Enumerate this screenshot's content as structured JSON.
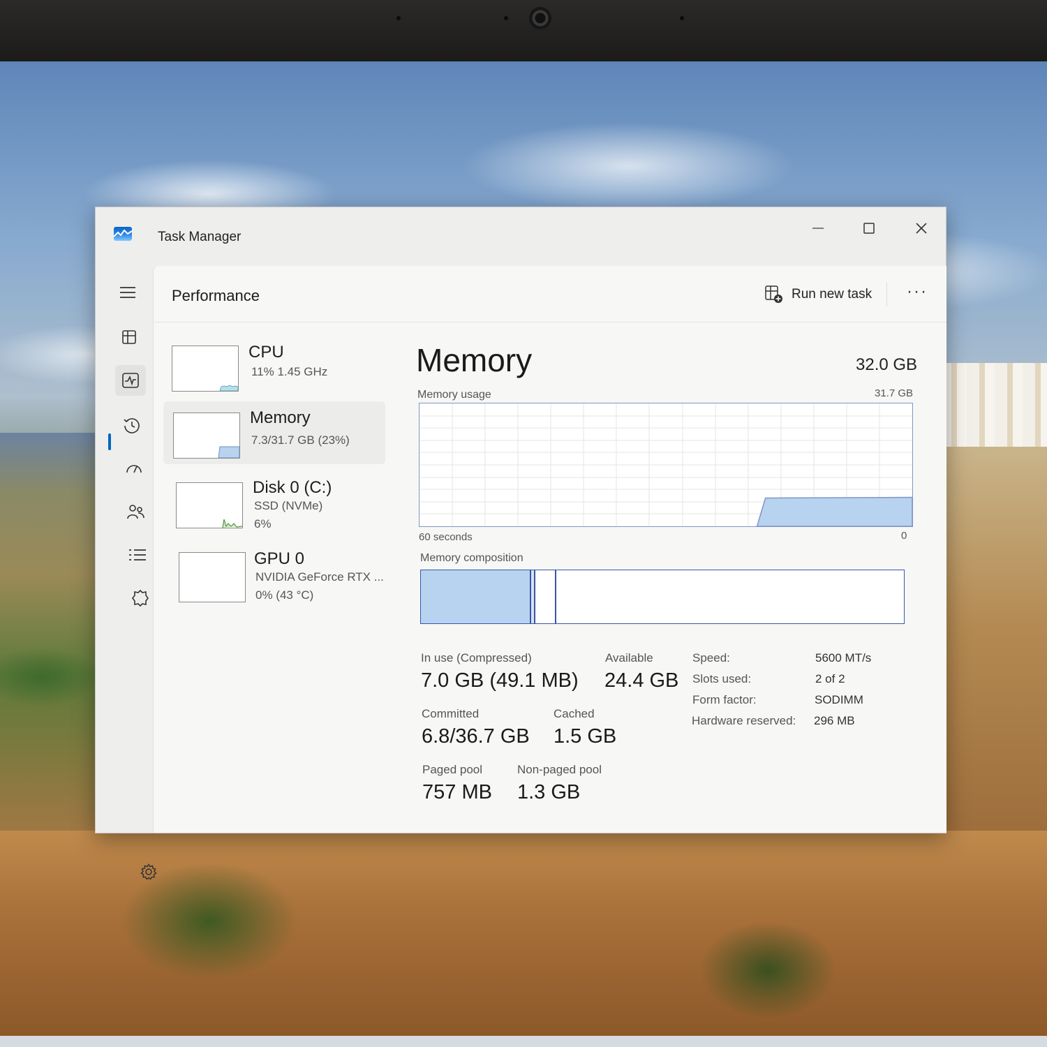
{
  "window": {
    "title": "Task Manager"
  },
  "header": {
    "page_title": "Performance",
    "run_new_task": "Run new task",
    "more": "···"
  },
  "devices": [
    {
      "name": "CPU",
      "line1": "11%  1.45 GHz",
      "line2": "",
      "usage_fraction": 0.11
    },
    {
      "name": "Memory",
      "line1": "7.3/31.7 GB (23%)",
      "line2": "",
      "usage_fraction": 0.23
    },
    {
      "name": "Disk 0 (C:)",
      "line1": "SSD (NVMe)",
      "line2": "6%",
      "usage_fraction": 0.06
    },
    {
      "name": "GPU 0",
      "line1": "NVIDIA GeForce RTX ...",
      "line2": "0%  (43 °C)",
      "usage_fraction": 0.0
    }
  ],
  "memory": {
    "title": "Memory",
    "total": "32.0 GB",
    "usage_label": "Memory usage",
    "usage_max": "31.7 GB",
    "axis_left": "60 seconds",
    "axis_right": "0",
    "composition_label": "Memory composition",
    "composition_fractions": {
      "in_use": 0.225,
      "modified": 0.005,
      "standby": 0.04
    },
    "usage_history_fraction_recent": 0.23,
    "stats": {
      "in_use_label": "In use (Compressed)",
      "in_use_value": "7.0 GB (49.1 MB)",
      "available_label": "Available",
      "available_value": "24.4 GB",
      "committed_label": "Committed",
      "committed_value": "6.8/36.7 GB",
      "cached_label": "Cached",
      "cached_value": "1.5 GB",
      "paged_label": "Paged pool",
      "paged_value": "757 MB",
      "nonpaged_label": "Non-paged pool",
      "nonpaged_value": "1.3 GB"
    },
    "specs": [
      {
        "label": "Speed:",
        "value": "5600 MT/s"
      },
      {
        "label": "Slots used:",
        "value": "2 of 2"
      },
      {
        "label": "Form factor:",
        "value": "SODIMM"
      },
      {
        "label": "Hardware reserved:",
        "value": "296 MB"
      }
    ]
  },
  "nav_icons": [
    "menu-icon",
    "processes-icon",
    "performance-icon",
    "app-history-icon",
    "startup-apps-icon",
    "users-icon",
    "details-icon",
    "services-icon",
    "settings-icon"
  ],
  "colors": {
    "accent": "#0067c0",
    "graph_fill": "#b8d3f0",
    "graph_line": "#7f96c6",
    "composition_border": "#3a55a8"
  }
}
